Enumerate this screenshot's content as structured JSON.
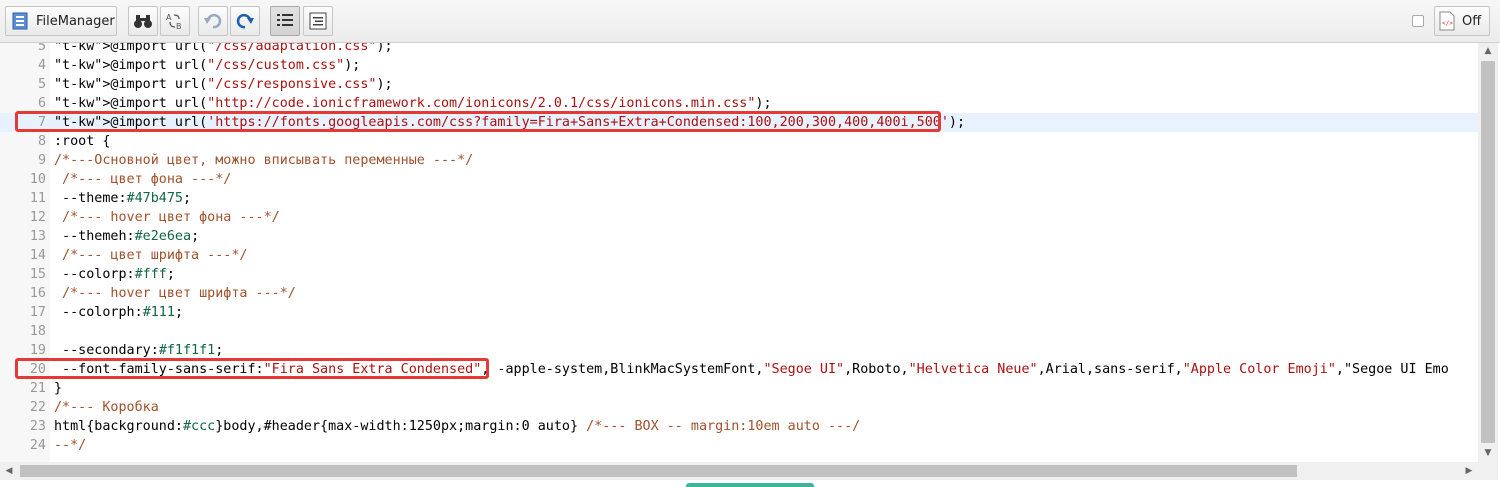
{
  "toolbar": {
    "file_manager_label": "FileManager",
    "off_label": "Off",
    "icons": [
      "file-manager-icon",
      "binoculars-icon",
      "replace-icon",
      "undo-icon",
      "redo-icon",
      "line-numbers-icon",
      "format-icon",
      "code-toggle-icon"
    ]
  },
  "editor": {
    "lines": [
      {
        "n": "5",
        "code": "@import url(\"/css/adaptation.css\");"
      },
      {
        "n": "4",
        "code": "@import url(\"/css/custom.css\");"
      },
      {
        "n": "5",
        "code": "@import url(\"/css/responsive.css\");"
      },
      {
        "n": "6",
        "code": "@import url(\"http://code.ionicframework.com/ionicons/2.0.1/css/ionicons.min.css\");"
      },
      {
        "n": "7",
        "code": "@import url('https://fonts.googleapis.com/css?family=Fira+Sans+Extra+Condensed:100,200,300,400,400i,500');"
      },
      {
        "n": "8",
        "code": ":root {"
      },
      {
        "n": "9",
        "code": "/*---Основной цвет, можно вписывать переменные ---*/"
      },
      {
        "n": "10",
        "code": " /*--- цвет фона ---*/"
      },
      {
        "n": "11",
        "code": " --theme:#47b475;"
      },
      {
        "n": "12",
        "code": " /*--- hover цвет фона ---*/"
      },
      {
        "n": "13",
        "code": " --themeh:#e2e6ea;"
      },
      {
        "n": "14",
        "code": " /*--- цвет шрифта ---*/"
      },
      {
        "n": "15",
        "code": " --colorp:#fff;"
      },
      {
        "n": "16",
        "code": " /*--- hover цвет шрифта ---*/"
      },
      {
        "n": "17",
        "code": " --colorph:#111;"
      },
      {
        "n": "18",
        "code": ""
      },
      {
        "n": "19",
        "code": " --secondary:#f1f1f1;"
      },
      {
        "n": "20",
        "code": " --font-family-sans-serif:\"Fira Sans Extra Condensed\", -apple-system,BlinkMacSystemFont,\"Segoe UI\",Roboto,\"Helvetica Neue\",Arial,sans-serif,\"Apple Color Emoji\",\"Segoe UI Emo"
      },
      {
        "n": "21",
        "code": "}"
      },
      {
        "n": "22",
        "code": "/*--- Коробка"
      },
      {
        "n": "23",
        "code": "html{background:#ccc}body,#header{max-width:1250px;margin:0 auto} /*--- BOX -- margin:10em auto ---/"
      },
      {
        "n": "24",
        "code": "--*/"
      }
    ]
  }
}
